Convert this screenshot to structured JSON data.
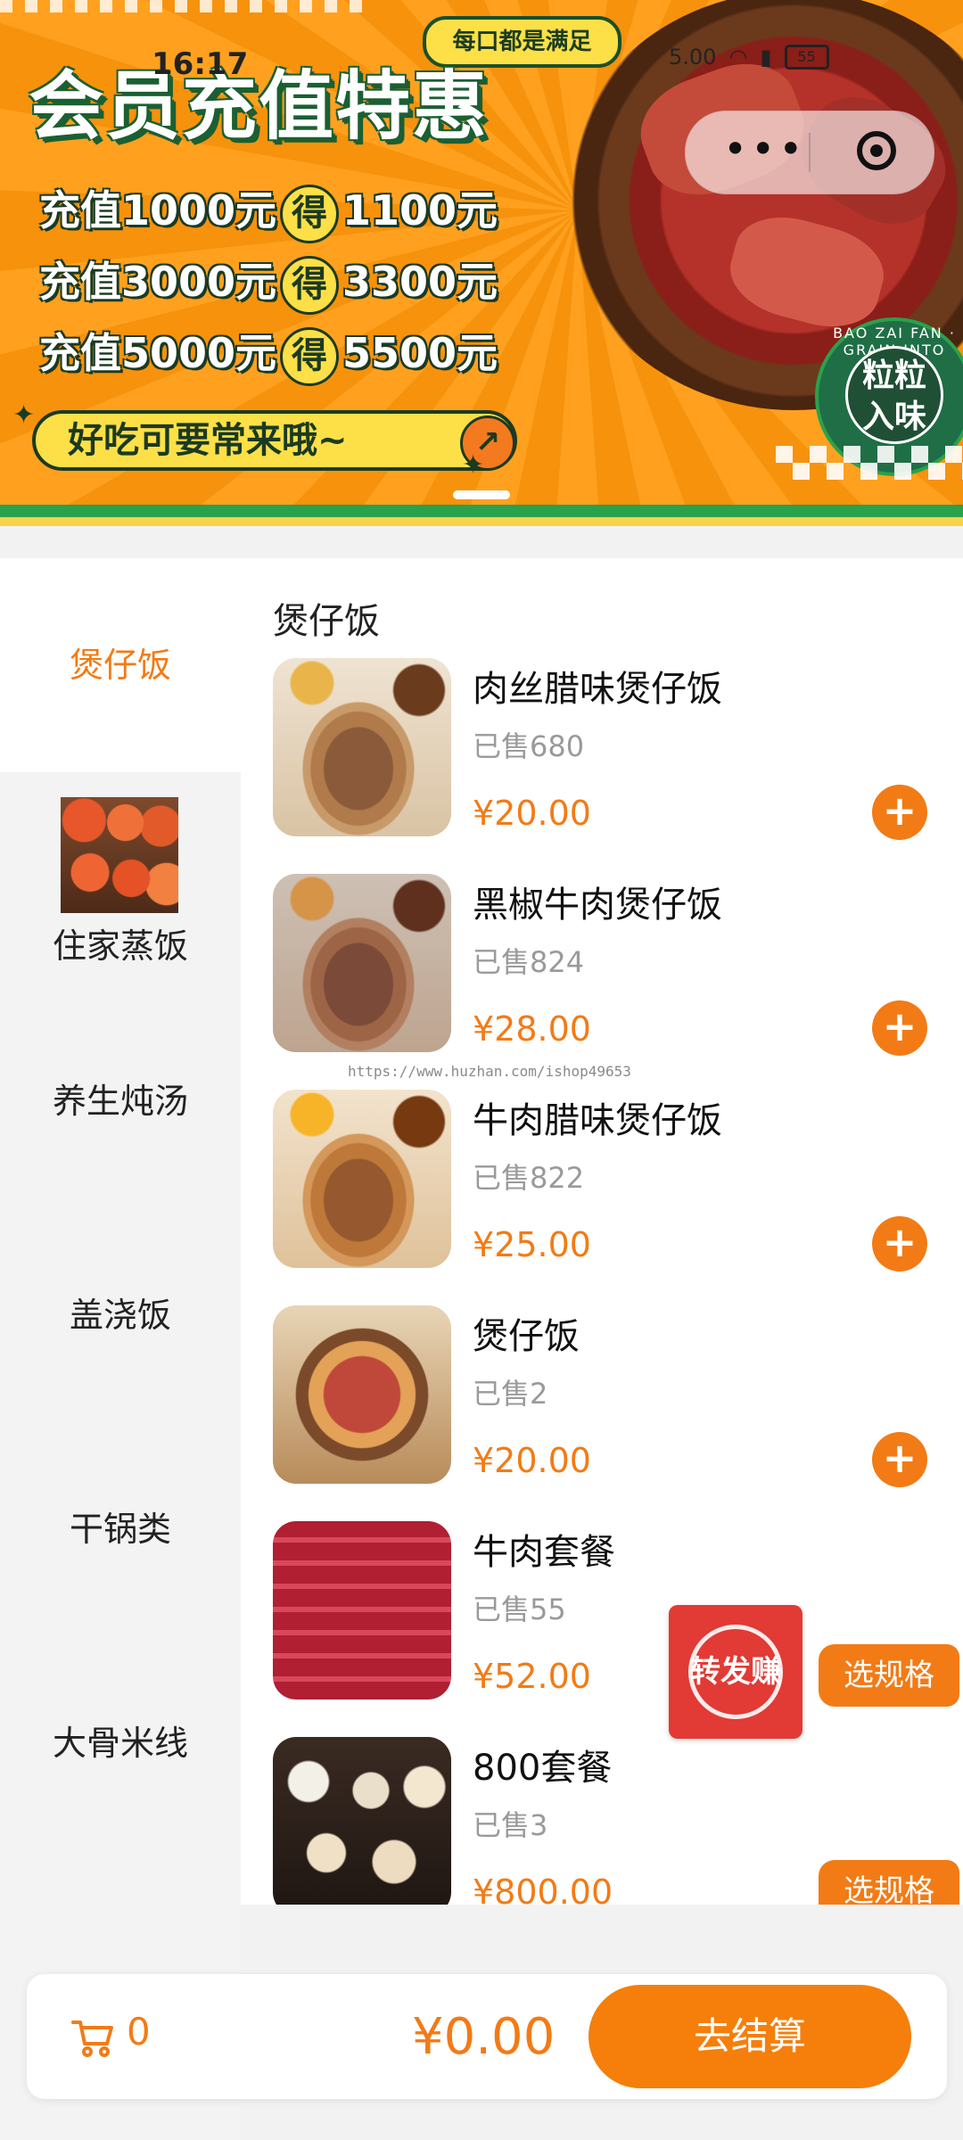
{
  "status": {
    "time": "16:17",
    "speed": "5.00",
    "battery": "55"
  },
  "banner": {
    "tag": "每口都是满足",
    "title": "会员充值特惠",
    "offers": [
      {
        "pay": "充值1000元",
        "mid": "得",
        "get": "1100元"
      },
      {
        "pay": "充值3000元",
        "mid": "得",
        "get": "3300元"
      },
      {
        "pay": "充值5000元",
        "mid": "得",
        "get": "5500元"
      }
    ],
    "slogan": "好吃可要常来哦~",
    "badge_main": "粒粒入味",
    "badge_ring": "BAO ZAI FAN · GRAIN INTO TASTE"
  },
  "capsule": {
    "more": "•••"
  },
  "sidebar": {
    "items": [
      {
        "label": "煲仔饭"
      },
      {
        "label": "住家蒸饭"
      },
      {
        "label": "养生炖汤"
      },
      {
        "label": "盖浇饭"
      },
      {
        "label": "干锅类"
      },
      {
        "label": "大骨米线"
      }
    ]
  },
  "main": {
    "section_title": "煲仔饭",
    "watermark": "https://www.huzhan.com/ishop49653",
    "products": [
      {
        "name": "肉丝腊味煲仔饭",
        "sold": "已售680",
        "price": "¥20.00",
        "action": "+"
      },
      {
        "name": "黑椒牛肉煲仔饭",
        "sold": "已售824",
        "price": "¥28.00",
        "action": "+"
      },
      {
        "name": "牛肉腊味煲仔饭",
        "sold": "已售822",
        "price": "¥25.00",
        "action": "+"
      },
      {
        "name": "煲仔饭",
        "sold": "已售2",
        "price": "¥20.00",
        "action": "+"
      },
      {
        "name": "牛肉套餐",
        "sold": "已售55",
        "price": "¥52.00",
        "action": "选规格"
      },
      {
        "name": "800套餐",
        "sold": "已售3",
        "price": "¥800.00",
        "action": "选规格"
      }
    ]
  },
  "share": {
    "label": "转发赚"
  },
  "cart": {
    "count": "0",
    "total": "¥0.00",
    "checkout": "去结算"
  },
  "colors": {
    "accent": "#f27b16",
    "banner": "#f7920c",
    "green": "#2aa14d"
  }
}
